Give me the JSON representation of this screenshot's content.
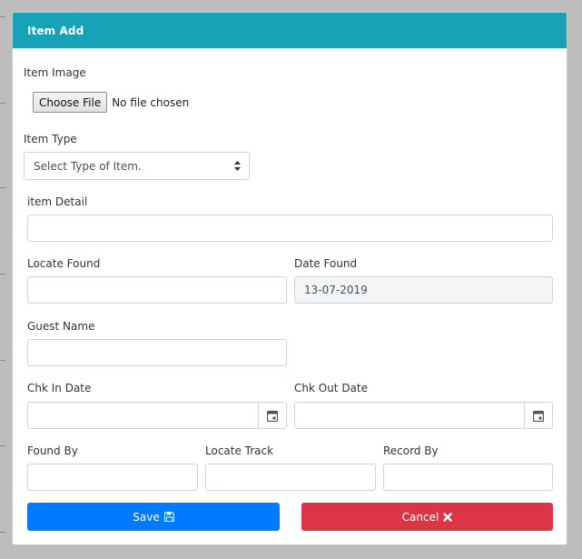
{
  "modal": {
    "title": "Item Add"
  },
  "form": {
    "item_image_label": "Item Image",
    "choose_file_label": "Choose File",
    "file_status": "No file chosen",
    "item_type_label": "Item Type",
    "item_type_selected": "Select Type of Item.",
    "item_detail_label": "item Detail",
    "item_detail_value": "",
    "locate_found_label": "Locate Found",
    "locate_found_value": "",
    "date_found_label": "Date Found",
    "date_found_value": "13-07-2019",
    "guest_name_label": "Guest Name",
    "guest_name_value": "",
    "chk_in_label": "Chk In Date",
    "chk_in_value": "",
    "chk_out_label": "Chk Out Date",
    "chk_out_value": "",
    "found_by_label": "Found By",
    "found_by_value": "",
    "locate_track_label": "Locate Track",
    "locate_track_value": "",
    "record_by_label": "Record By",
    "record_by_value": ""
  },
  "actions": {
    "save_label": "Save",
    "cancel_label": "Cancel"
  },
  "colors": {
    "header": "#17a2b8",
    "save": "#007bff",
    "cancel": "#dc3545"
  },
  "icons": {
    "save": "floppy-disk-icon",
    "cancel": "x-icon",
    "calendar": "calendar-icon",
    "select": "sort-arrows-icon"
  }
}
